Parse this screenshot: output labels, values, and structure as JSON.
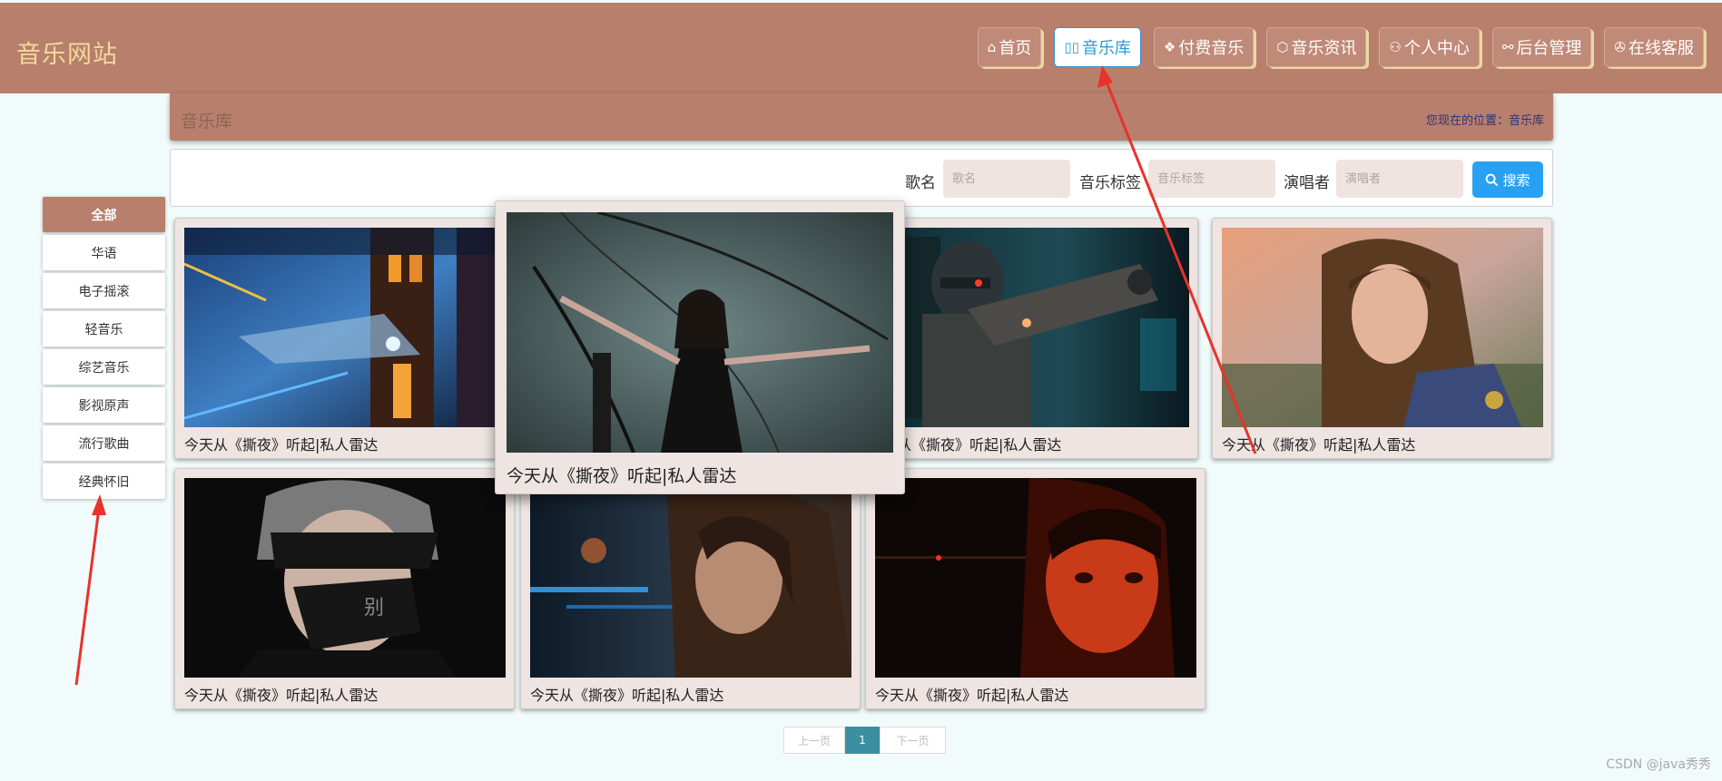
{
  "header": {
    "logo": "音乐网站",
    "nav": [
      {
        "icon": "⌂",
        "icon_name": "home-icon",
        "label": "首页"
      },
      {
        "icon": "▯▯",
        "icon_name": "library-icon",
        "label": "音乐库"
      },
      {
        "icon": "❖",
        "icon_name": "layers-icon",
        "label": "付费音乐"
      },
      {
        "icon": "⬡",
        "icon_name": "cube-icon",
        "label": "音乐资讯"
      },
      {
        "icon": "⚇",
        "icon_name": "user-icon",
        "label": "个人中心"
      },
      {
        "icon": "⚯",
        "icon_name": "link-icon",
        "label": "后台管理"
      },
      {
        "icon": "✇",
        "icon_name": "chrome-icon",
        "label": "在线客服"
      }
    ],
    "active_index": 1
  },
  "breadcrumb": {
    "title": "音乐库",
    "location": "您现在的位置：音乐库"
  },
  "search": {
    "fields": [
      {
        "label": "歌名",
        "placeholder": "歌名"
      },
      {
        "label": "音乐标签",
        "placeholder": "音乐标签"
      },
      {
        "label": "演唱者",
        "placeholder": "演唱者"
      }
    ],
    "button_label": "搜索"
  },
  "sidebar": {
    "items": [
      "全部",
      "华语",
      "电子摇滚",
      "轻音乐",
      "综艺音乐",
      "影视原声",
      "流行歌曲",
      "经典怀旧"
    ],
    "active_index": 0
  },
  "cards": [
    {
      "caption": "今天从《撕夜》听起|私人雷达",
      "image": "sci-fi-city"
    },
    {
      "caption": "今天从《撕夜》听起|私人雷达",
      "image": "woman-black-dress"
    },
    {
      "caption": "今天从《撕夜》听起|私人雷达",
      "image": "cyber-soldier"
    },
    {
      "caption": "今天从《撕夜》听起|私人雷达",
      "image": "fantasy-woman"
    },
    {
      "caption": "今天从《撕夜》听起|私人雷达",
      "image": "man-gloved-hand"
    },
    {
      "caption": "今天从《撕夜》听起|私人雷达",
      "image": "woman-night"
    },
    {
      "caption": "今天从《撕夜》听起|私人雷达",
      "image": "man-red-light"
    }
  ],
  "pagination": {
    "prev": "上一页",
    "current": "1",
    "next": "下一页"
  },
  "watermark": "CSDN @java秀秀",
  "colors": {
    "header_bg": "#b87f6d",
    "logo": "#f4d89a",
    "active_nav_text": "#2a9bd4",
    "search_button": "#28a1f2",
    "annotation_arrow": "#e8322b"
  }
}
